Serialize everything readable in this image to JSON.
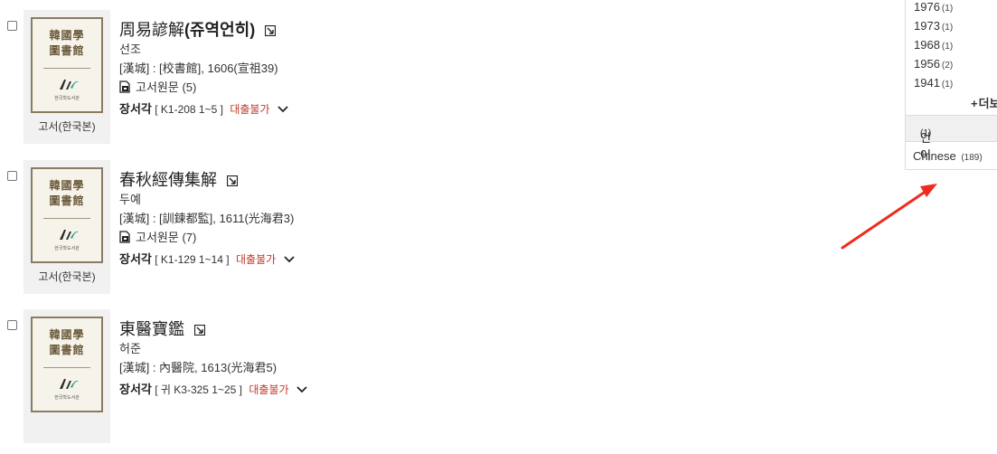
{
  "results": [
    {
      "title_main": "周易諺解",
      "title_paren": "(쥬역언히)",
      "author": "선조",
      "publication": "[漢城] : [校書館], 1606(宣祖39)",
      "original_link": "고서원문 (5)",
      "library": "장서각",
      "callno": "[ K1-208 1~5 ]",
      "loan_status": "대출불가",
      "thumb_label": "고서(한국본)",
      "cover_text": "韓國學 圖書館"
    },
    {
      "title_main": "春秋經傳集解",
      "title_paren": "",
      "author": "두예",
      "publication": "[漢城] : [訓鍊都監], 1611(光海君3)",
      "original_link": "고서원문 (7)",
      "library": "장서각",
      "callno": "[ K1-129 1~14 ]",
      "loan_status": "대출불가",
      "thumb_label": "고서(한국본)",
      "cover_text": "韓國學 圖書館"
    },
    {
      "title_main": "東醫寶鑑",
      "title_paren": "",
      "author": "허준",
      "publication": "[漢城] : 內醫院, 1613(光海君5)",
      "original_link": "",
      "library": "장서각",
      "callno": "[ 귀 K3-325 1~25 ]",
      "loan_status": "대출불가",
      "thumb_label": "",
      "cover_text": "韓國學 圖書館"
    }
  ],
  "facet": {
    "years": [
      {
        "label": "1976",
        "count": "(1)"
      },
      {
        "label": "1973",
        "count": "(1)"
      },
      {
        "label": "1968",
        "count": "(1)"
      },
      {
        "label": "1956",
        "count": "(2)"
      },
      {
        "label": "1941",
        "count": "(1)"
      }
    ],
    "more_label": "더보",
    "language_heading": "언어",
    "language_heading_count": "(1)",
    "languages": [
      {
        "label": "Chinese",
        "count": "(189)"
      }
    ]
  },
  "colors": {
    "loan_status": "#c0392b",
    "annotation_arrow": "#ee2b1d",
    "thumb_bg": "#f1f1f1"
  }
}
